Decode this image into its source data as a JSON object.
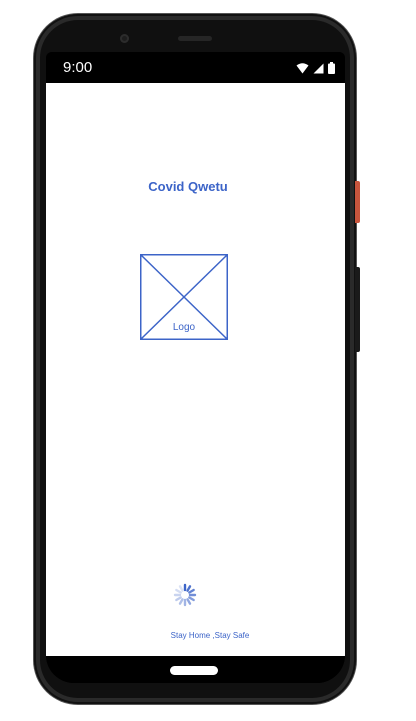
{
  "status_bar": {
    "time": "9:00",
    "icons": [
      "wifi-icon",
      "cellular-signal-icon",
      "battery-icon"
    ]
  },
  "app": {
    "title": "Covid Qwetu",
    "logo_label": "Logo",
    "tagline": "Stay Home ,Stay Safe",
    "loading_indicator": "spinner-icon"
  },
  "colors": {
    "accent": "#3c64c8",
    "background": "#ffffff",
    "status_bar": "#000000"
  }
}
